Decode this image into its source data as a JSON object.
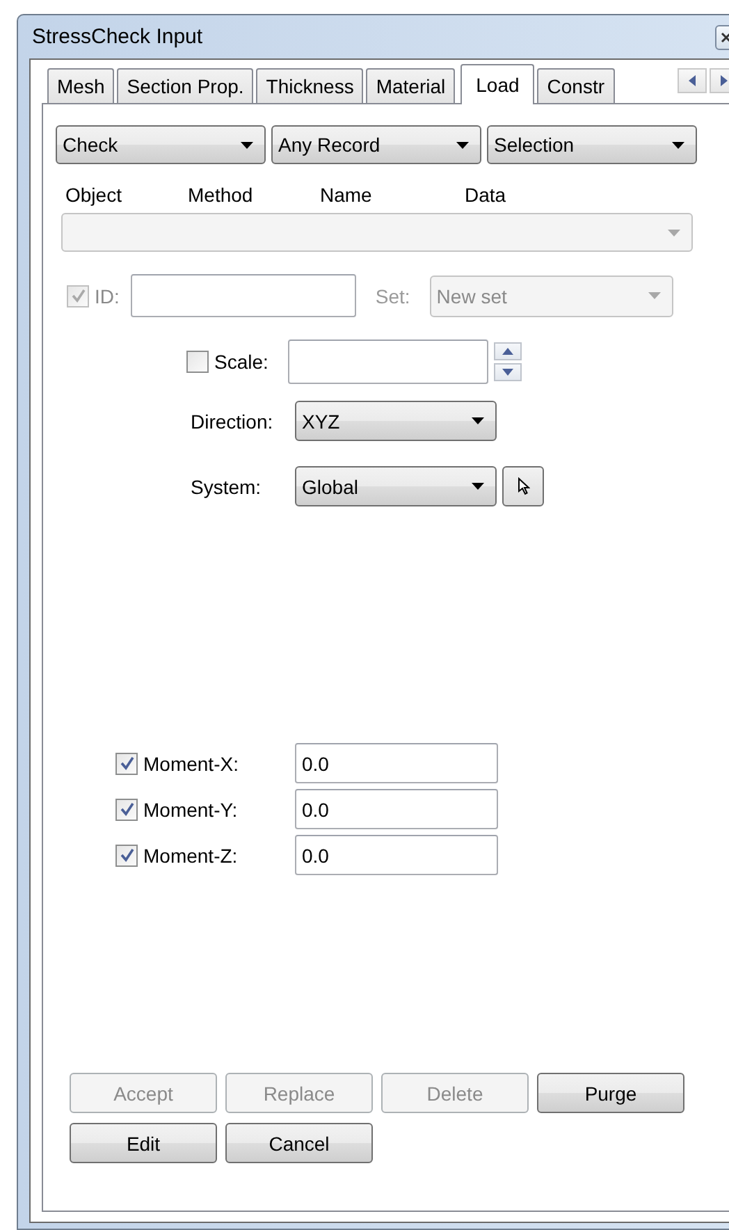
{
  "window": {
    "title": "StressCheck Input"
  },
  "tabs": [
    {
      "label": "Mesh",
      "selected": false
    },
    {
      "label": "Section Prop.",
      "selected": false
    },
    {
      "label": "Thickness",
      "selected": false
    },
    {
      "label": "Material",
      "selected": false
    },
    {
      "label": "Load",
      "selected": true
    },
    {
      "label": "Constr",
      "selected": false
    }
  ],
  "filters": [
    {
      "value": "Check"
    },
    {
      "value": "Any Record"
    },
    {
      "value": "Selection"
    }
  ],
  "list_headers": [
    "Object",
    "Method",
    "Name",
    "Data"
  ],
  "record_list": {
    "disabled": true
  },
  "id_field": {
    "label": "ID:",
    "checked": true,
    "disabled": true
  },
  "set_field": {
    "label": "Set:",
    "value": "New set",
    "disabled": true
  },
  "scale": {
    "label": "Scale:",
    "checked": false
  },
  "direction": {
    "label": "Direction:",
    "value": "XYZ"
  },
  "system": {
    "label": "System:",
    "value": "Global"
  },
  "moments": [
    {
      "label": "Moment-X:",
      "checked": true,
      "value": "0.0"
    },
    {
      "label": "Moment-Y:",
      "checked": true,
      "value": "0.0"
    },
    {
      "label": "Moment-Z:",
      "checked": true,
      "value": "0.0"
    }
  ],
  "button_rows": [
    [
      {
        "label": "Accept",
        "disabled": true
      },
      {
        "label": "Replace",
        "disabled": true
      },
      {
        "label": "Delete",
        "disabled": true
      },
      {
        "label": "Purge",
        "disabled": false
      }
    ],
    [
      {
        "label": "Edit",
        "disabled": false
      },
      {
        "label": "Cancel",
        "disabled": false
      }
    ]
  ]
}
